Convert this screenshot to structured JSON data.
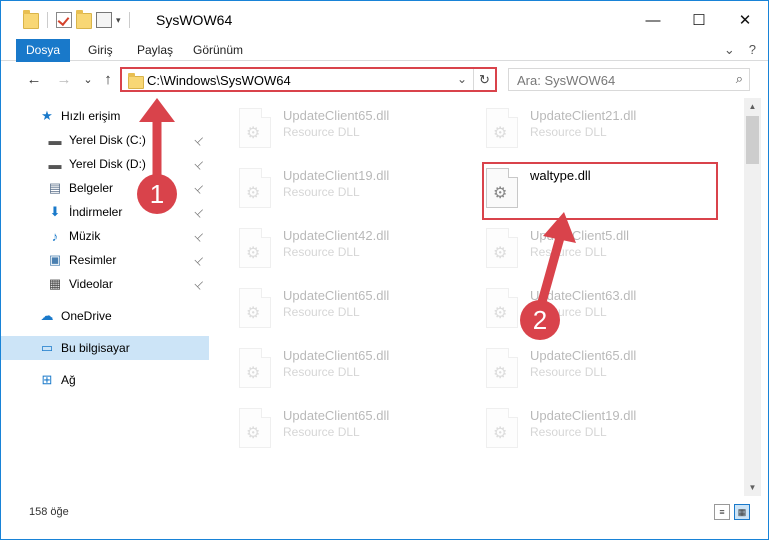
{
  "window": {
    "title": "SysWOW64"
  },
  "titlebar": {
    "quick_access_dropdown": "▾",
    "minimize": "—",
    "maximize": "☐",
    "close": "✕"
  },
  "ribbon": {
    "tabs": [
      "Dosya",
      "Giriş",
      "Paylaş",
      "Görünüm"
    ],
    "expand_icon": "⌄",
    "help_icon": "?"
  },
  "address": {
    "back": "←",
    "forward": "→",
    "recent": "⌄",
    "up": "↑",
    "path": "C:\\Windows\\SysWOW64",
    "dropdown": "⌄",
    "refresh": "↻",
    "search_placeholder": "Ara: SysWOW64",
    "search_icon": "⌕"
  },
  "nav": {
    "items": [
      {
        "label": "Hızlı erişim",
        "icon": "star-icon",
        "glyph": "★",
        "color": "#1979ca",
        "pinned": false,
        "selected": false,
        "level": 1
      },
      {
        "label": "Yerel Disk (C:)",
        "icon": "drive-icon",
        "glyph": "▬",
        "color": "#555555",
        "pinned": true,
        "selected": false,
        "level": 2
      },
      {
        "label": "Yerel Disk (D:)",
        "icon": "drive-icon",
        "glyph": "▬",
        "color": "#555555",
        "pinned": true,
        "selected": false,
        "level": 2
      },
      {
        "label": "Belgeler",
        "icon": "documents-icon",
        "glyph": "▤",
        "color": "#5a6f8a",
        "pinned": true,
        "selected": false,
        "level": 2
      },
      {
        "label": "İndirmeler",
        "icon": "download-icon",
        "glyph": "⬇",
        "color": "#1979ca",
        "pinned": true,
        "selected": false,
        "level": 2
      },
      {
        "label": "Müzik",
        "icon": "music-icon",
        "glyph": "♪",
        "color": "#1979ca",
        "pinned": true,
        "selected": false,
        "level": 2
      },
      {
        "label": "Resimler",
        "icon": "pictures-icon",
        "glyph": "▣",
        "color": "#4a7fb0",
        "pinned": true,
        "selected": false,
        "level": 2
      },
      {
        "label": "Videolar",
        "icon": "videos-icon",
        "glyph": "▦",
        "color": "#444444",
        "pinned": true,
        "selected": false,
        "level": 2
      },
      {
        "label": "OneDrive",
        "icon": "cloud-icon",
        "glyph": "☁",
        "color": "#1979ca",
        "pinned": false,
        "selected": false,
        "level": 1
      },
      {
        "label": "Bu bilgisayar",
        "icon": "computer-icon",
        "glyph": "▭",
        "color": "#1979ca",
        "pinned": false,
        "selected": true,
        "level": 1
      },
      {
        "label": "Ağ",
        "icon": "network-icon",
        "glyph": "⊞",
        "color": "#1979ca",
        "pinned": false,
        "selected": false,
        "level": 1
      }
    ],
    "pin_glyph": "📌"
  },
  "files": {
    "left": [
      {
        "name": "UpdateClient65.dll",
        "type": "Resource DLL"
      },
      {
        "name": "UpdateClient19.dll",
        "type": "Resource DLL"
      },
      {
        "name": "UpdateClient42.dll",
        "type": "Resource DLL"
      },
      {
        "name": "UpdateClient65.dll",
        "type": "Resource DLL"
      },
      {
        "name": "UpdateClient65.dll",
        "type": "Resource DLL"
      },
      {
        "name": "UpdateClient65.dll",
        "type": "Resource DLL"
      }
    ],
    "right": [
      {
        "name": "UpdateClient21.dll",
        "type": "Resource DLL",
        "faded": true
      },
      {
        "name": "waltype.dll",
        "type": "",
        "faded": false
      },
      {
        "name": "UpdateClient5.dll",
        "type": "Resource DLL",
        "faded": true
      },
      {
        "name": "UpdateClient63.dll",
        "type": "Resource DLL",
        "faded": true
      },
      {
        "name": "UpdateClient65.dll",
        "type": "Resource DLL",
        "faded": true
      },
      {
        "name": "UpdateClient19.dll",
        "type": "Resource DLL",
        "faded": true
      }
    ]
  },
  "status": {
    "count": "158 öğe"
  },
  "annotations": {
    "badge1": "1",
    "badge2": "2",
    "color": "#d9434b"
  }
}
